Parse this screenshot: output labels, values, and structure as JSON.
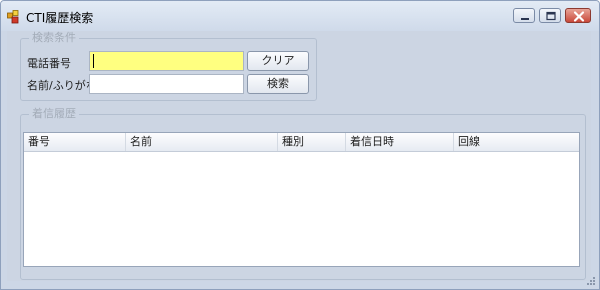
{
  "window": {
    "title": "CTI履歴検索",
    "icon": "app-icon",
    "controls": {
      "minimize": "minimize-icon",
      "maximize": "maximize-icon",
      "close": "close-icon"
    }
  },
  "search_group": {
    "legend": "検索条件",
    "phone_label": "電話番号",
    "phone_value": "",
    "name_label": "名前/ふりがな",
    "name_value": "",
    "clear_button": "クリア",
    "search_button": "検索"
  },
  "history_group": {
    "legend": "着信履歴",
    "columns": [
      "番号",
      "名前",
      "種別",
      "着信日時",
      "回線"
    ],
    "rows": []
  },
  "colors": {
    "active_field": "#ffff80",
    "window_bg": "#ccd5e3",
    "close_button": "#c9483a"
  }
}
